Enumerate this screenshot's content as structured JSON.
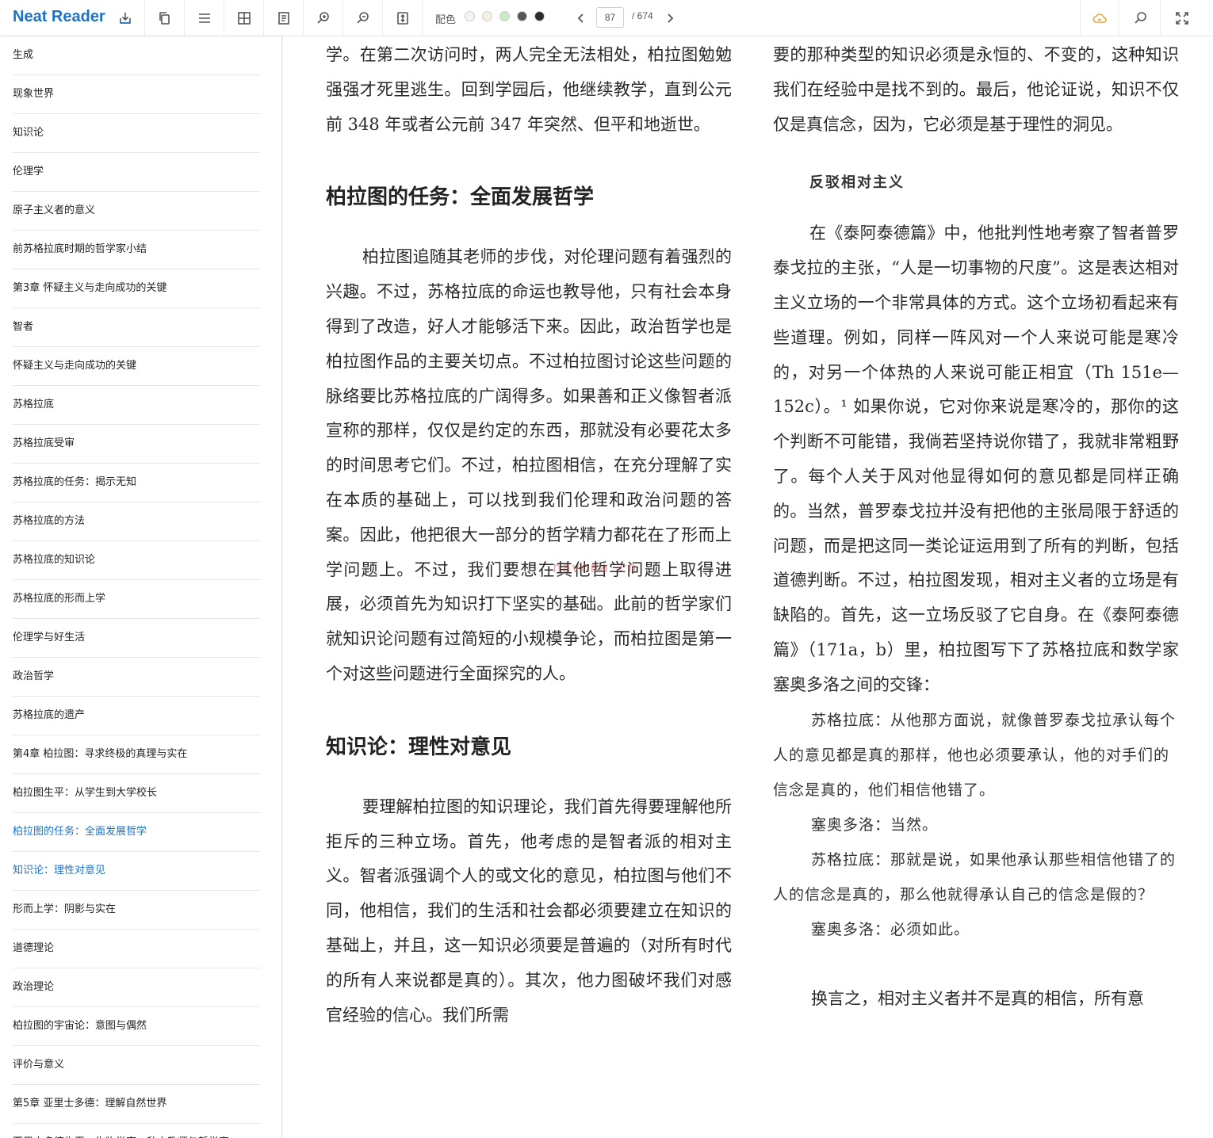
{
  "app": {
    "brand": "Neat Reader"
  },
  "toolbar": {
    "color_label": "配色",
    "swatches": [
      "#f3f3f3",
      "#f5f0e1",
      "#c8ecc4",
      "#555555",
      "#2b2b2b"
    ],
    "page_current": "87",
    "page_total": "/ 674",
    "icons": [
      "save-icon",
      "copy-icon",
      "menu-icon",
      "grid-icon",
      "notes-icon",
      "zoom-in-icon",
      "zoom-out-icon",
      "fit-height-icon",
      "cloud-sync-icon",
      "search-icon",
      "fullscreen-icon"
    ],
    "accent": "#1a73c8"
  },
  "sidebar": {
    "items": [
      {
        "label": "生成"
      },
      {
        "label": "现象世界"
      },
      {
        "label": "知识论"
      },
      {
        "label": "伦理学"
      },
      {
        "label": "原子主义者的意义"
      },
      {
        "label": "前苏格拉底时期的哲学家小结"
      },
      {
        "label": "第3章 怀疑主义与走向成功的关键"
      },
      {
        "label": "智者"
      },
      {
        "label": "怀疑主义与走向成功的关键"
      },
      {
        "label": "苏格拉底"
      },
      {
        "label": "苏格拉底受审"
      },
      {
        "label": "苏格拉底的任务：揭示无知"
      },
      {
        "label": "苏格拉底的方法"
      },
      {
        "label": "苏格拉底的知识论"
      },
      {
        "label": "苏格拉底的形而上学"
      },
      {
        "label": "伦理学与好生活"
      },
      {
        "label": "政治哲学"
      },
      {
        "label": "苏格拉底的遗产"
      },
      {
        "label": "第4章 柏拉图：寻求终极的真理与实在"
      },
      {
        "label": "柏拉图生平：从学生到大学校长"
      },
      {
        "label": "柏拉图的任务：全面发展哲学"
      },
      {
        "label": "知识论：理性对意见"
      },
      {
        "label": "形而上学：阴影与实在"
      },
      {
        "label": "道德理论"
      },
      {
        "label": "政治理论"
      },
      {
        "label": "柏拉图的宇宙论：意图与偶然"
      },
      {
        "label": "评价与意义"
      },
      {
        "label": "第5章 亚里士多德：理解自然世界"
      },
      {
        "label": "亚里士多德生平：生物学家、私人教师与哲学家"
      }
    ],
    "active_labels": [
      "柏拉图的任务：全面发展哲学",
      "知识论：理性对意见"
    ]
  },
  "content": {
    "left": {
      "p1": "学。在第二次访问时，两人完全无法相处，柏拉图勉勉强强才死里逃生。回到学园后，他继续教学，直到公元前 348 年或者公元前 347 年突然、但平和地逝世。",
      "h1": "柏拉图的任务：全面发展哲学",
      "p2": "柏拉图追随其老师的步伐，对伦理问题有着强烈的兴趣。不过，苏格拉底的命运也教导他，只有社会本身得到了改造，好人才能够活下来。因此，政治哲学也是柏拉图作品的主要关切点。不过柏拉图讨论这些问题的脉络要比苏格拉底的广阔得多。如果善和正义像智者派宣称的那样，仅仅是约定的东西，那就没有必要花太多的时间思考它们。不过，柏拉图相信，在充分理解了实在本质的基础上，可以找到我们伦理和政治问题的答案。因此，他把很大一部分的哲学精力都花在了形而上学问题上。不过，我们要想在其他哲学问题上取得进展，必须首先为知识打下坚实的基础。此前的哲学家们就知识论问题有过简短的小规模争论，而柏拉图是第一个对这些问题进行全面探究的人。",
      "h2": "知识论：理性对意见",
      "p3": "要理解柏拉图的知识理论，我们首先得要理解他所拒斥的三种立场。首先，他考虑的是智者派的相对主义。智者派强调个人的或文化的意见，柏拉图与他们不同，他相信，我们的生活和社会都必须要建立在知识的基础上，并且，这一知识必须要是普遍的（对所有时代的所有人来说都是真的）。其次，他力图破坏我们对感官经验的信心。我们所需"
    },
    "right": {
      "p1": "要的那种类型的知识必须是永恒的、不变的，这种知识我们在经验中是找不到的。最后，他论证说，知识不仅仅是真信念，因为，它必须是基于理性的洞见。",
      "h1": "反驳相对主义",
      "p2": "在《泰阿泰德篇》中，他批判性地考察了智者普罗泰戈拉的主张，“人是一切事物的尺度”。这是表达相对主义立场的一个非常具体的方式。这个立场初看起来有些道理。例如，同样一阵风对一个人来说可能是寒冷的，对另一个体热的人来说可能正相宜（Th 151e—152c）。¹ 如果你说，它对你来说是寒冷的，那你的这个判断不可能错，我倘若坚持说你错了，我就非常粗野了。每个人关于风对他显得如何的意见都是同样正确的。当然，普罗泰戈拉并没有把他的主张局限于舒适的问题，而是把这同一类论证运用到了所有的判断，包括道德判断。不过，柏拉图发现，相对主义者的立场是有缺陷的。首先，这一立场反驳了它自身。在《泰阿泰德篇》（171a，b）里，柏拉图写下了苏格拉底和数学家塞奥多洛之间的交锋：",
      "d1": "苏格拉底：从他那方面说，就像普罗泰戈拉承认每个人的意见都是真的那样，他也必须要承认，他的对手们的信念是真的，他们相信他错了。",
      "d2": "塞奥多洛：当然。",
      "d3": "苏格拉底：那就是说，如果他承认那些相信他错了的人的信念是真的，那么他就得承认自己的信念是假的？",
      "d4": "塞奥多洛：必须如此。",
      "p3": "换言之，相对主义者并不是真的相信，所有意"
    },
    "watermark": "navona.cn"
  }
}
